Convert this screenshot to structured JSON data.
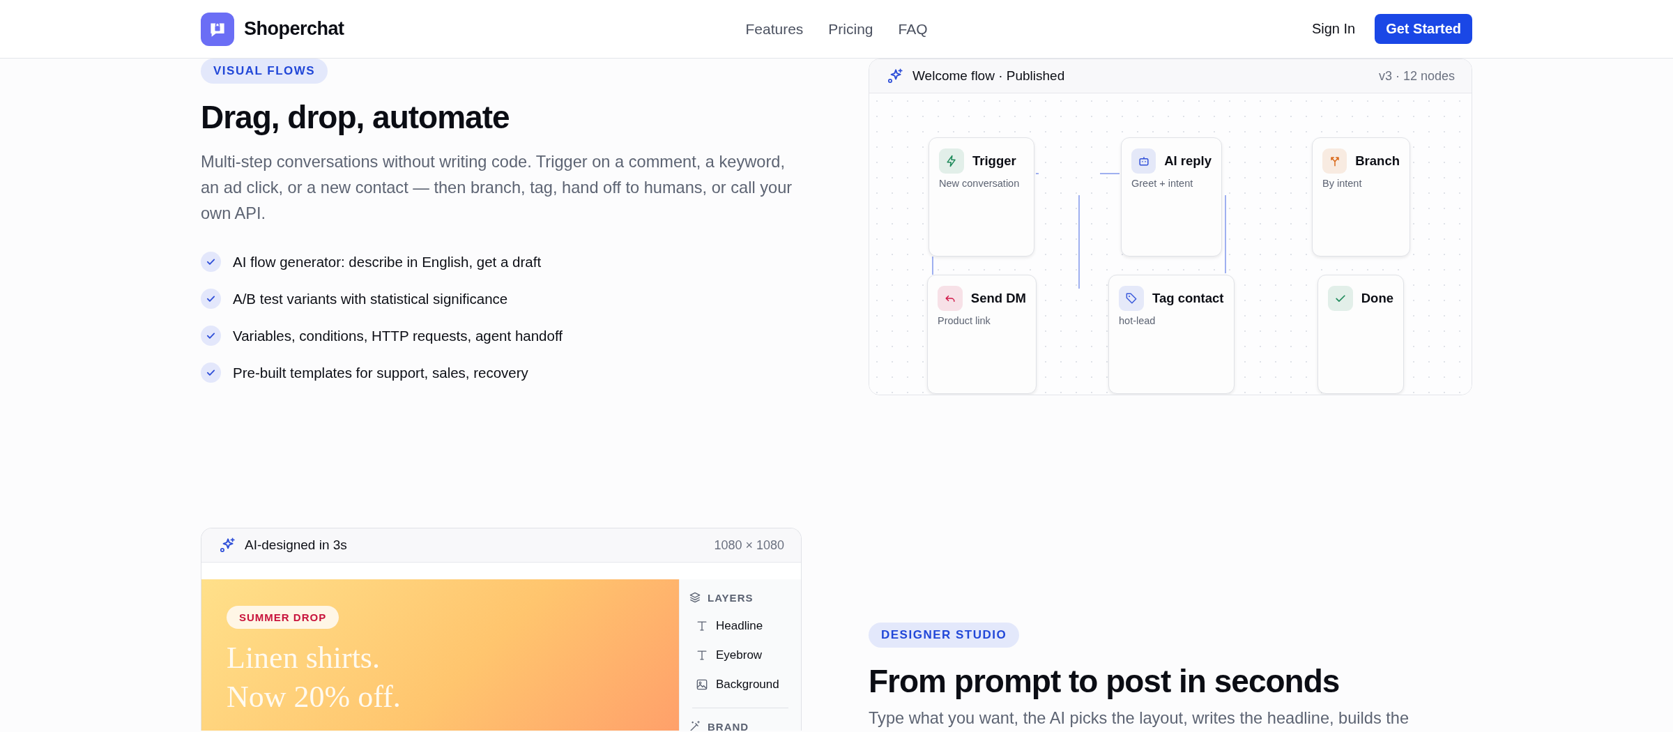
{
  "header": {
    "brand": "Shoperchat",
    "nav": [
      {
        "label": "Features"
      },
      {
        "label": "Pricing"
      },
      {
        "label": "FAQ"
      }
    ],
    "sign_in": "Sign In",
    "cta": "Get Started"
  },
  "flows_section": {
    "badge": "VISUAL FLOWS",
    "title": "Drag, drop, automate",
    "description": "Multi-step conversations without writing code. Trigger on a comment, a keyword, an ad click, or a new contact — then branch, tag, hand off to humans, or call your own API.",
    "features": [
      "AI flow generator: describe in English, get a draft",
      "A/B test variants with statistical significance",
      "Variables, conditions, HTTP requests, agent handoff",
      "Pre-built templates for support, sales, recovery"
    ]
  },
  "flow_card": {
    "title": "Welcome flow · Published",
    "meta": "v3 · 12 nodes",
    "nodes": [
      {
        "kind": "trigger",
        "title": "Trigger",
        "subtitle": "New conversation",
        "color": "#1f8a5b"
      },
      {
        "kind": "ai",
        "title": "AI reply",
        "subtitle": "Greet + intent",
        "color": "#2f4fd8"
      },
      {
        "kind": "branch",
        "title": "Branch",
        "subtitle": "By intent",
        "color": "#d9691a"
      },
      {
        "kind": "send",
        "title": "Send DM",
        "subtitle": "Product link",
        "color": "#d11a4a"
      },
      {
        "kind": "tag",
        "title": "Tag contact",
        "subtitle": "hot-lead",
        "color": "#3b5bdb"
      },
      {
        "kind": "done",
        "title": "Done",
        "color": "#1f8a5b"
      }
    ]
  },
  "design_card": {
    "title": "AI-designed in 3s",
    "size": "1080 × 1080",
    "canvas": {
      "eyebrow": "SUMMER DROP",
      "headline": "Linen shirts. Now 20% off."
    },
    "layers_heading": "LAYERS",
    "layers": [
      {
        "kind": "text",
        "label": "Headline"
      },
      {
        "kind": "text",
        "label": "Eyebrow"
      },
      {
        "kind": "image",
        "label": "Background"
      }
    ],
    "brand_heading": "BRAND"
  },
  "studio_section": {
    "badge": "DESIGNER STUDIO",
    "title": "From prompt to post in seconds",
    "description": "Type what you want, the AI picks the layout, writes the headline, builds the"
  }
}
